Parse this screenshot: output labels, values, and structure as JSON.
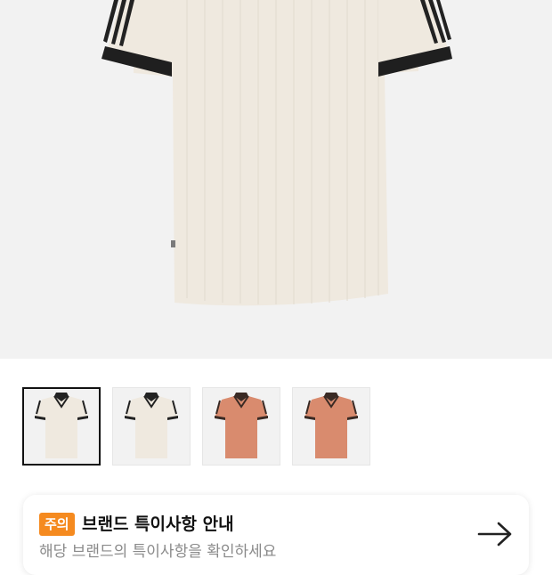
{
  "product": {
    "main_image_icon": "polo-shirt-cream",
    "thumbnails": [
      {
        "icon": "polo-shirt-cream",
        "body_color": "#efe9df",
        "collar_color": "#222222",
        "selected": true
      },
      {
        "icon": "polo-shirt-cream",
        "body_color": "#efe9df",
        "collar_color": "#222222",
        "selected": false
      },
      {
        "icon": "polo-shirt-salmon",
        "body_color": "#d98b6e",
        "collar_color": "#3a2a24",
        "selected": false
      },
      {
        "icon": "polo-shirt-salmon",
        "body_color": "#d98b6e",
        "collar_color": "#3a2a24",
        "selected": false
      }
    ]
  },
  "notice": {
    "badge": "주의",
    "title": "브랜드 특이사항 안내",
    "subtitle": "해당 브랜드의 특이사항을 확인하세요",
    "arrow_icon": "arrow-right-icon",
    "badge_color": "#f58a1f"
  }
}
